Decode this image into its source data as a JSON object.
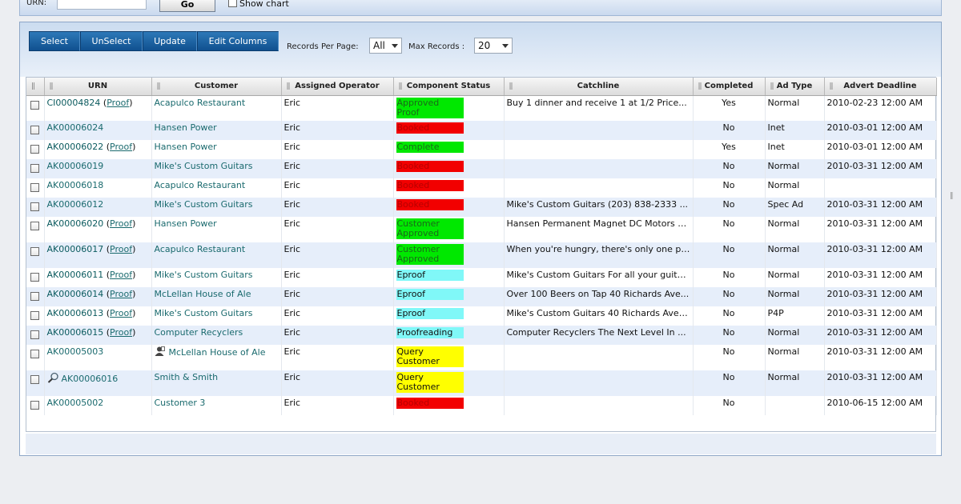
{
  "search": {
    "urn_label": "URN:",
    "urn_value": "",
    "go_label": "Go",
    "show_chart_label": "Show chart"
  },
  "toolbar": {
    "select_label": "Select",
    "unselect_label": "UnSelect",
    "update_label": "Update",
    "edit_columns_label": "Edit Columns",
    "records_per_page_label": "Records Per Page:",
    "records_per_page_value": "All",
    "max_records_label": "Max Records :",
    "max_records_value": "20"
  },
  "colors": {
    "approved": "#00e800",
    "booked": "#f20000",
    "complete": "#00e800",
    "eproof": "#80f8f8",
    "proofreading": "#80f8f8",
    "query": "#ffff00"
  },
  "columns": [
    "URN",
    "Customer",
    "Assigned Operator",
    "Component Status",
    "Catchline",
    "Completed",
    "Ad Type",
    "Advert Deadline"
  ],
  "rows": [
    {
      "urn": "CI00004824",
      "proof": "Proof",
      "customer": "Acapulco Restaurant",
      "operator": "Eric",
      "status": "Approved Proof",
      "status_color": "#00e800",
      "status_text_color": "#1a6a1a",
      "catchline": "Buy 1 dinner and receive 1 at 1/2 Price...",
      "completed": "Yes",
      "ad_type": "Normal",
      "deadline": "2010-02-23 12:00 AM",
      "icon": ""
    },
    {
      "urn": "AK00006024",
      "proof": "",
      "customer": "Hansen Power",
      "operator": "Eric",
      "status": "Booked",
      "status_color": "#f20000",
      "status_text_color": "#b80000",
      "catchline": "",
      "completed": "No",
      "ad_type": "Inet",
      "deadline": "2010-03-01 12:00 AM",
      "icon": ""
    },
    {
      "urn": "AK00006022",
      "proof": "Proof",
      "customer": "Hansen Power",
      "operator": "Eric",
      "status": "Complete",
      "status_color": "#00e800",
      "status_text_color": "#1a6a1a",
      "catchline": "",
      "completed": "Yes",
      "ad_type": "Inet",
      "deadline": "2010-03-01 12:00 AM",
      "icon": ""
    },
    {
      "urn": "AK00006019",
      "proof": "",
      "customer": "Mike's Custom Guitars",
      "operator": "Eric",
      "status": "Booked",
      "status_color": "#f20000",
      "status_text_color": "#b80000",
      "catchline": "",
      "completed": "No",
      "ad_type": "Normal",
      "deadline": "2010-03-31 12:00 AM",
      "icon": ""
    },
    {
      "urn": "AK00006018",
      "proof": "",
      "customer": "Acapulco Restaurant",
      "operator": "Eric",
      "status": "Booked",
      "status_color": "#f20000",
      "status_text_color": "#b80000",
      "catchline": "",
      "completed": "No",
      "ad_type": "Normal",
      "deadline": "",
      "icon": ""
    },
    {
      "urn": "AK00006012",
      "proof": "",
      "customer": "Mike's Custom Guitars",
      "operator": "Eric",
      "status": "Booked",
      "status_color": "#f20000",
      "status_text_color": "#b80000",
      "catchline": "Mike's Custom Guitars (203) 838-2333 ...",
      "completed": "No",
      "ad_type": "Spec Ad",
      "deadline": "2010-03-31 12:00 AM",
      "icon": ""
    },
    {
      "urn": "AK00006020",
      "proof": "Proof",
      "customer": "Hansen Power",
      "operator": "Eric",
      "status": "Customer Approved",
      "status_color": "#00e800",
      "status_text_color": "#1a6a1a",
      "catchline": "Hansen Permanent Magnet DC Motors h...",
      "completed": "No",
      "ad_type": "Normal",
      "deadline": "2010-03-31 12:00 AM",
      "icon": ""
    },
    {
      "urn": "AK00006017",
      "proof": "Proof",
      "customer": "Acapulco Restaurant",
      "operator": "Eric",
      "status": "Customer Approved",
      "status_color": "#00e800",
      "status_text_color": "#1a6a1a",
      "catchline": "When you're hungry, there's only one pl...",
      "completed": "No",
      "ad_type": "Normal",
      "deadline": "2010-03-31 12:00 AM",
      "icon": ""
    },
    {
      "urn": "AK00006011",
      "proof": "Proof",
      "customer": "Mike's Custom Guitars",
      "operator": "Eric",
      "status": "Eproof",
      "status_color": "#80f8f8",
      "status_text_color": "#111111",
      "catchline": "Mike's Custom Guitars For all your guita...",
      "completed": "No",
      "ad_type": "Normal",
      "deadline": "2010-03-31 12:00 AM",
      "icon": ""
    },
    {
      "urn": "AK00006014",
      "proof": "Proof",
      "customer": "McLellan House of Ale",
      "operator": "Eric",
      "status": "Eproof",
      "status_color": "#80f8f8",
      "status_text_color": "#111111",
      "catchline": "Over 100 Beers on Tap 40 Richards Ave...",
      "completed": "No",
      "ad_type": "Normal",
      "deadline": "2010-03-31 12:00 AM",
      "icon": ""
    },
    {
      "urn": "AK00006013",
      "proof": "Proof",
      "customer": "Mike's Custom Guitars",
      "operator": "Eric",
      "status": "Eproof",
      "status_color": "#80f8f8",
      "status_text_color": "#111111",
      "catchline": "Mike's Custom Guitars 40 Richards Ave ...",
      "completed": "No",
      "ad_type": "P4P",
      "deadline": "2010-03-31 12:00 AM",
      "icon": ""
    },
    {
      "urn": "AK00006015",
      "proof": "Proof",
      "customer": "Computer Recyclers",
      "operator": "Eric",
      "status": "Proofreading",
      "status_color": "#80f8f8",
      "status_text_color": "#111111",
      "catchline": "Computer Recyclers The Next Level In ...",
      "completed": "No",
      "ad_type": "Normal",
      "deadline": "2010-03-31 12:00 AM",
      "icon": ""
    },
    {
      "urn": "AK00005003",
      "proof": "",
      "customer": "McLellan House of Ale",
      "operator": "Eric",
      "status": "Query Customer",
      "status_color": "#ffff00",
      "status_text_color": "#111111",
      "catchline": "",
      "completed": "No",
      "ad_type": "Normal",
      "deadline": "2010-03-31 12:00 AM",
      "icon": "person"
    },
    {
      "urn": "AK00006016",
      "proof": "",
      "customer": "Smith & Smith",
      "operator": "Eric",
      "status": "Query Customer",
      "status_color": "#ffff00",
      "status_text_color": "#111111",
      "catchline": "",
      "completed": "No",
      "ad_type": "Normal",
      "deadline": "2010-03-31 12:00 AM",
      "icon": "magnifier"
    },
    {
      "urn": "AK00005002",
      "proof": "",
      "customer": "Customer 3",
      "operator": "Eric",
      "status": "Booked",
      "status_color": "#f20000",
      "status_text_color": "#b80000",
      "catchline": "",
      "completed": "No",
      "ad_type": "",
      "deadline": "2010-06-15 12:00 AM",
      "icon": ""
    }
  ]
}
